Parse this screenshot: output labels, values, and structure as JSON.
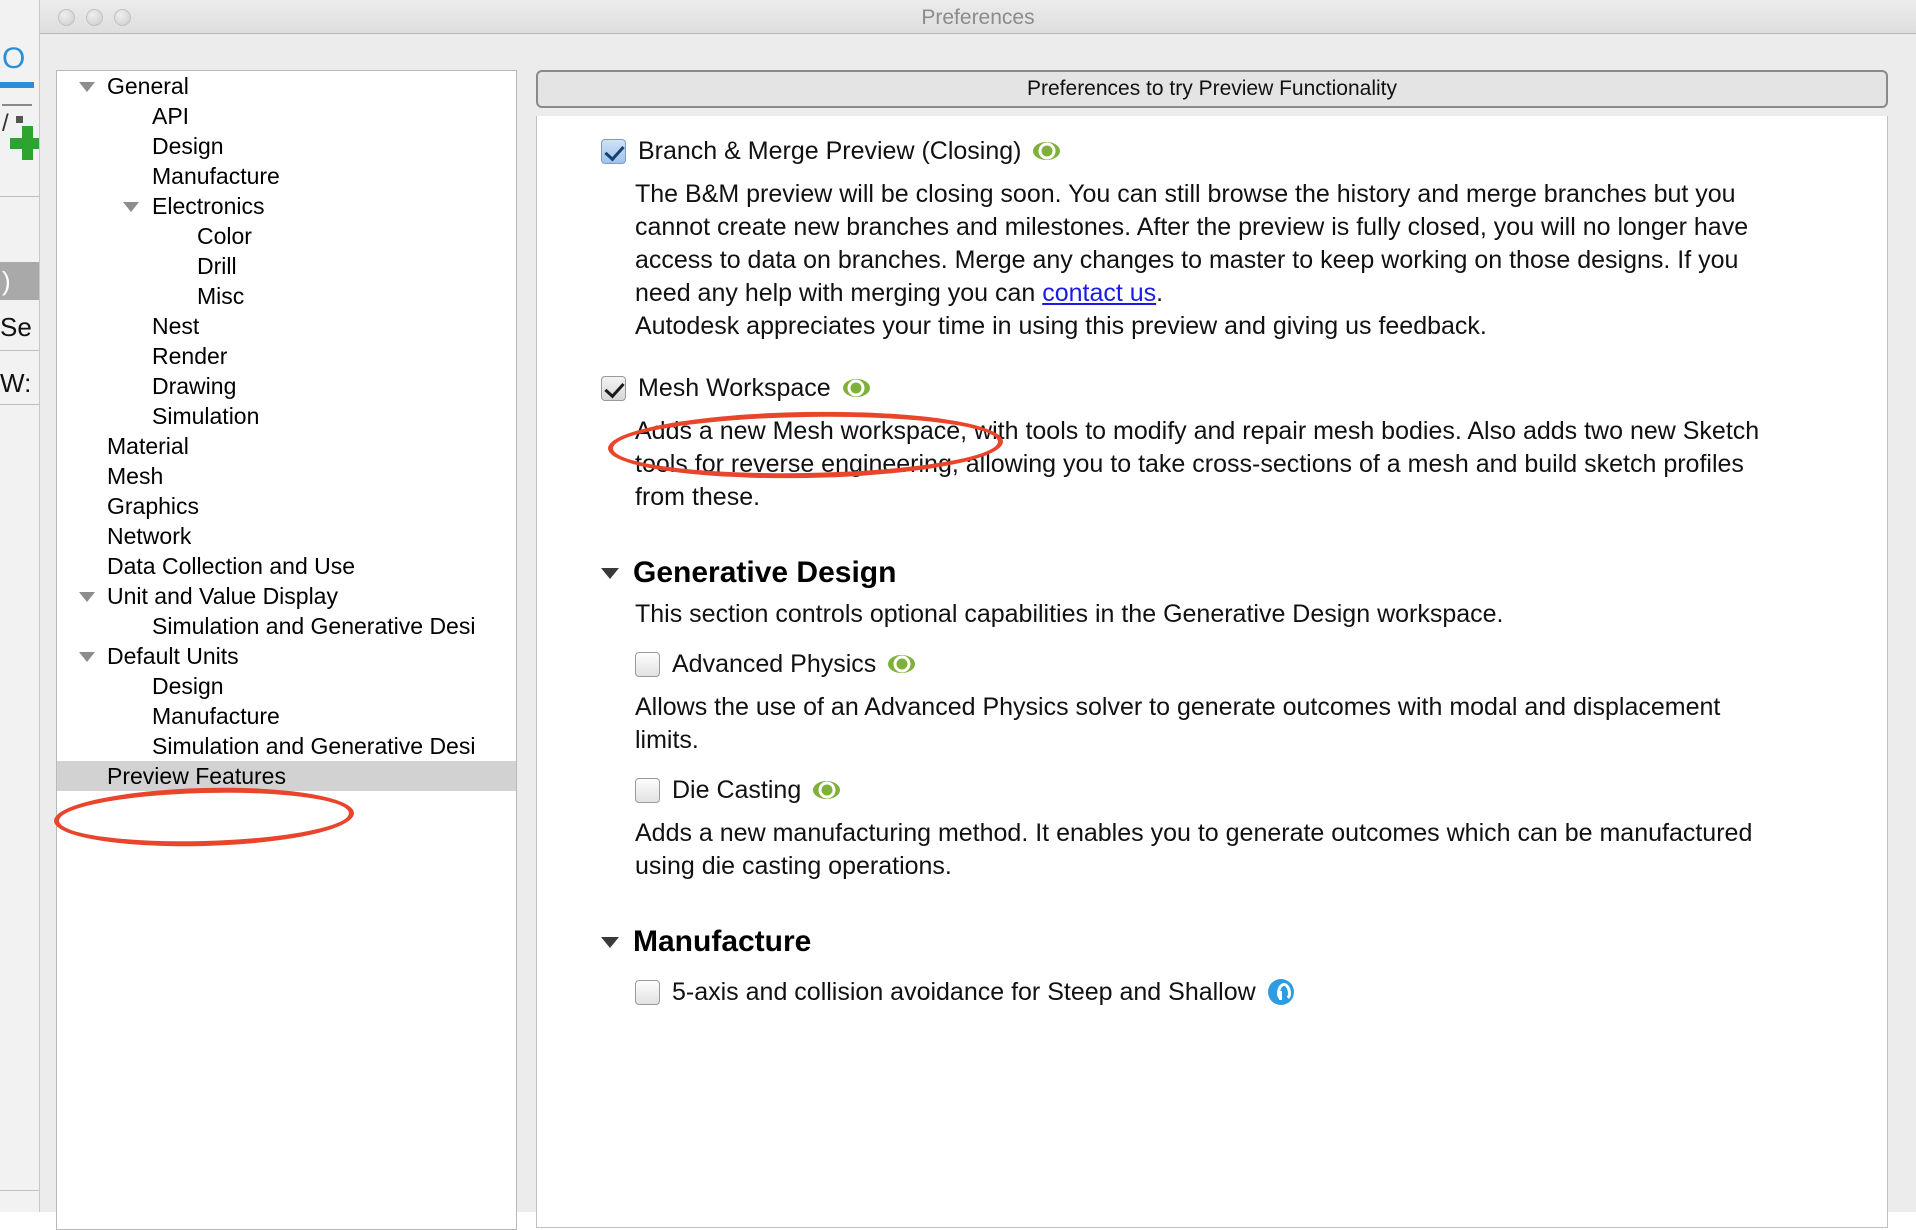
{
  "background_app": {
    "fragments": [
      "O",
      "/",
      ")",
      "Se",
      "W:"
    ]
  },
  "window": {
    "title": "Preferences",
    "traffic_lights": [
      "close",
      "minimize",
      "zoom"
    ]
  },
  "sidebar": {
    "items": [
      {
        "label": "General",
        "depth": 0,
        "twisty": "down",
        "selected": false
      },
      {
        "label": "API",
        "depth": 1,
        "twisty": "none",
        "selected": false
      },
      {
        "label": "Design",
        "depth": 1,
        "twisty": "none",
        "selected": false
      },
      {
        "label": "Manufacture",
        "depth": 1,
        "twisty": "none",
        "selected": false
      },
      {
        "label": "Electronics",
        "depth": 1,
        "twisty": "down",
        "selected": false
      },
      {
        "label": "Color",
        "depth": 2,
        "twisty": "none",
        "selected": false
      },
      {
        "label": "Drill",
        "depth": 2,
        "twisty": "none",
        "selected": false
      },
      {
        "label": "Misc",
        "depth": 2,
        "twisty": "none",
        "selected": false
      },
      {
        "label": "Nest",
        "depth": 1,
        "twisty": "none",
        "selected": false
      },
      {
        "label": "Render",
        "depth": 1,
        "twisty": "none",
        "selected": false
      },
      {
        "label": "Drawing",
        "depth": 1,
        "twisty": "none",
        "selected": false
      },
      {
        "label": "Simulation",
        "depth": 1,
        "twisty": "none",
        "selected": false
      },
      {
        "label": "Material",
        "depth": 0,
        "twisty": "none",
        "selected": false
      },
      {
        "label": "Mesh",
        "depth": 0,
        "twisty": "none",
        "selected": false
      },
      {
        "label": "Graphics",
        "depth": 0,
        "twisty": "none",
        "selected": false
      },
      {
        "label": "Network",
        "depth": 0,
        "twisty": "none",
        "selected": false
      },
      {
        "label": "Data Collection and Use",
        "depth": 0,
        "twisty": "none",
        "selected": false
      },
      {
        "label": "Unit and Value Display",
        "depth": 0,
        "twisty": "down",
        "selected": false
      },
      {
        "label": "Simulation and Generative Desi…",
        "depth": 1,
        "twisty": "none",
        "selected": false
      },
      {
        "label": "Default Units",
        "depth": 0,
        "twisty": "down",
        "selected": false
      },
      {
        "label": "Design",
        "depth": 1,
        "twisty": "none",
        "selected": false
      },
      {
        "label": "Manufacture",
        "depth": 1,
        "twisty": "none",
        "selected": false
      },
      {
        "label": "Simulation and Generative Desi…",
        "depth": 1,
        "twisty": "none",
        "selected": false
      },
      {
        "label": "Preview Features",
        "depth": 0,
        "twisty": "none",
        "selected": true
      }
    ]
  },
  "panel": {
    "header": "Preferences to try Preview Functionality",
    "branch_merge": {
      "label": "Branch & Merge Preview (Closing)",
      "checked": true,
      "checkbox_style": "blue",
      "eye_icon": "visibility-eye-icon",
      "description_part1": "The B&M preview will be closing soon. You can still browse the history and merge branches but you cannot create new branches and milestones. After the preview is fully closed, you will no longer have access to data on branches. Merge any changes to master to keep working on those designs. If you need any help with merging you can ",
      "link_text": "contact us",
      "description_part2": ".",
      "description_line2": "Autodesk appreciates your time in using this preview and giving us feedback."
    },
    "mesh_workspace": {
      "label": "Mesh Workspace",
      "checked": true,
      "checkbox_style": "gray",
      "eye_icon": "visibility-eye-icon",
      "description": "Adds a new Mesh workspace, with tools to modify and repair mesh bodies. Also adds two new Sketch tools for reverse engineering, allowing you to take cross-sections of a mesh and build sketch profiles from these."
    },
    "generative_design": {
      "title": "Generative Design",
      "expanded": true,
      "description": "This section controls optional capabilities in the Generative Design workspace.",
      "options": [
        {
          "label": "Advanced Physics",
          "checked": false,
          "eye_icon": "visibility-eye-icon",
          "description": "Allows the use of an Advanced Physics solver to generate outcomes with modal and displacement limits."
        },
        {
          "label": "Die Casting",
          "checked": false,
          "eye_icon": "visibility-eye-icon",
          "description": "Adds a new manufacturing method. It enables you to generate outcomes which can be manufactured using die casting operations."
        }
      ]
    },
    "manufacture": {
      "title": "Manufacture",
      "expanded": true,
      "options": [
        {
          "label": "5-axis and collision avoidance for Steep and Shallow",
          "checked": false,
          "badge_icon": "blue-wrench-badge-icon"
        }
      ]
    }
  },
  "annotations": {
    "color": "#e8452b",
    "ellipses": [
      "preview-features-sidebar-item",
      "mesh-workspace-row"
    ]
  }
}
